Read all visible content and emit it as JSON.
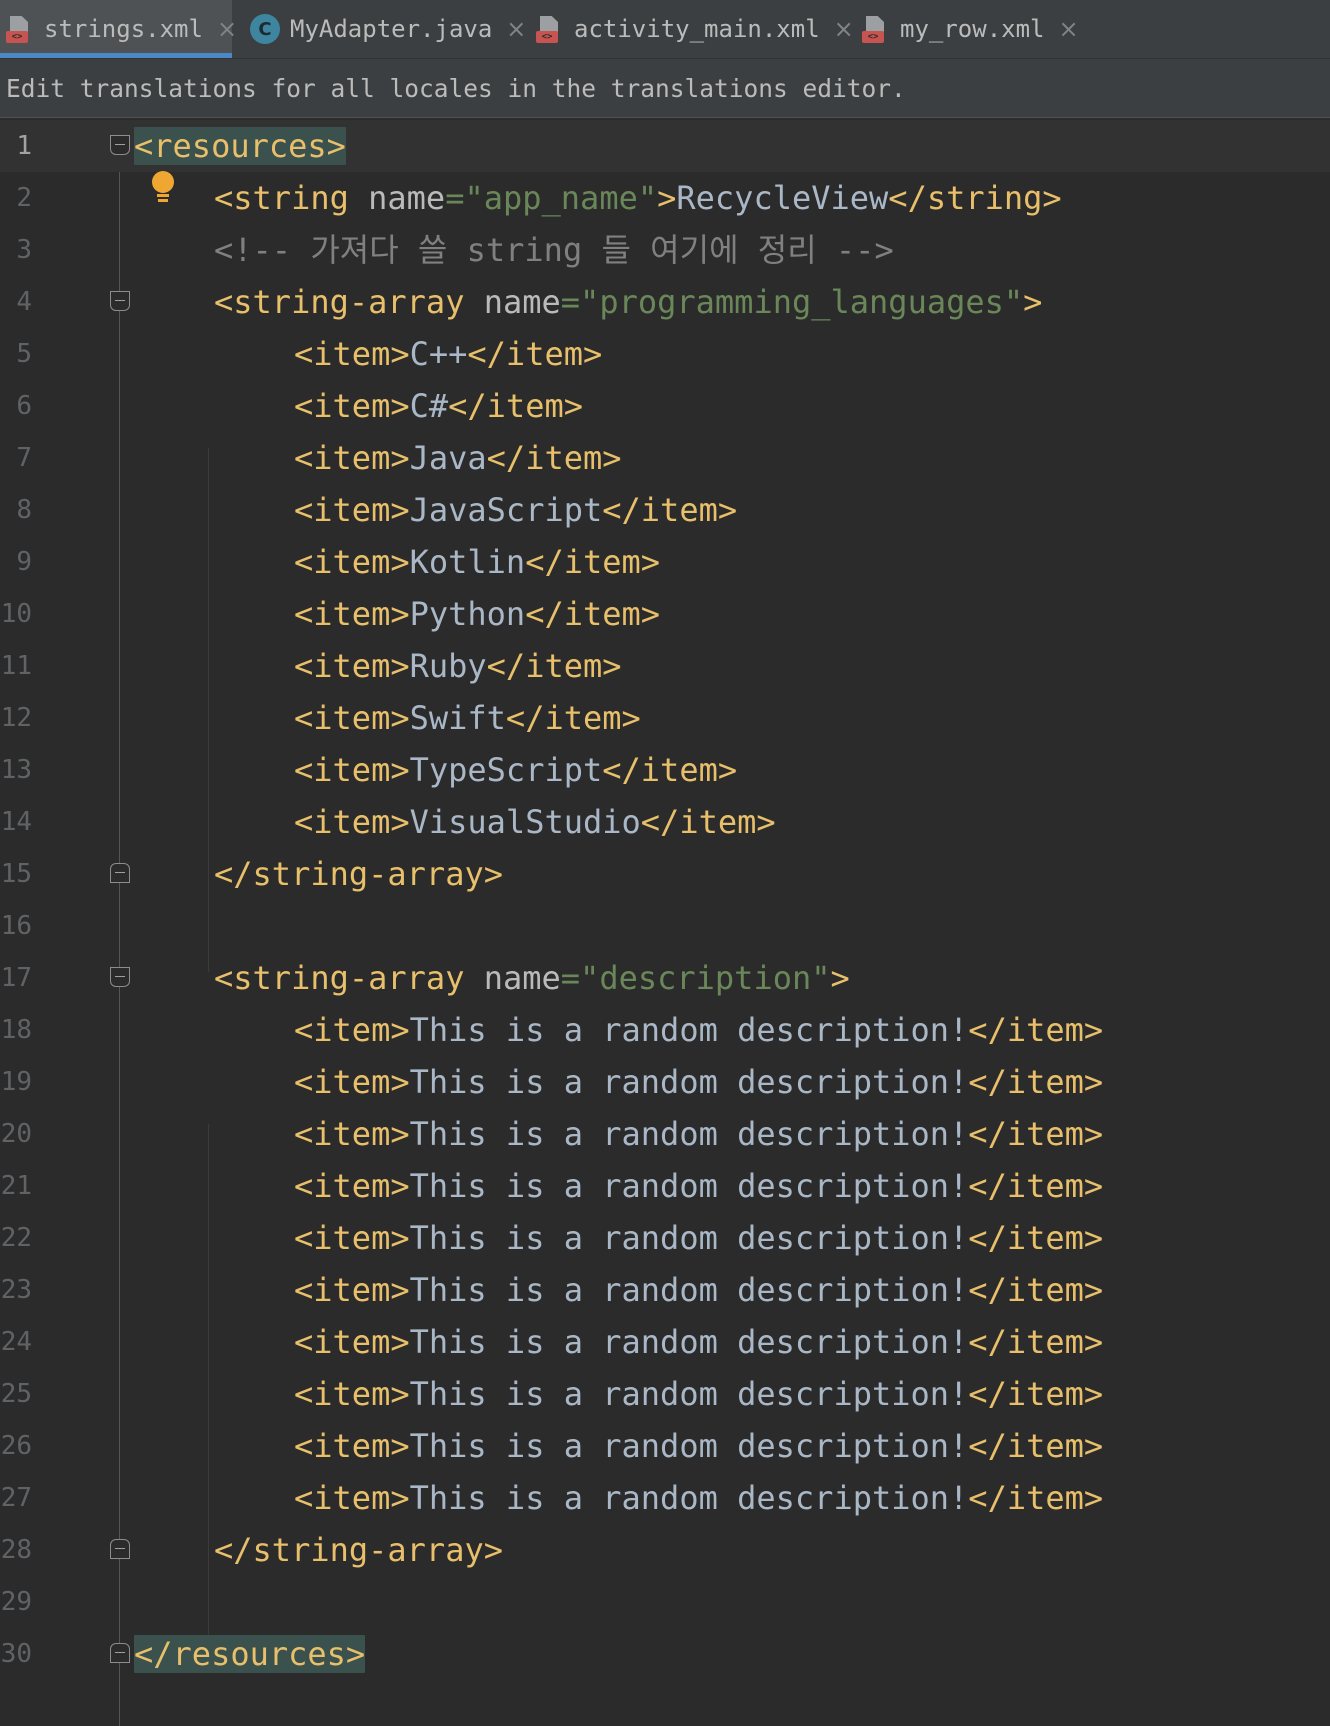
{
  "tabs": [
    {
      "label": "strings.xml",
      "icon": "xml-file-icon",
      "active": true
    },
    {
      "label": "MyAdapter.java",
      "icon": "java-class-icon",
      "active": false
    },
    {
      "label": "activity_main.xml",
      "icon": "xml-file-icon",
      "active": false
    },
    {
      "label": "my_row.xml",
      "icon": "xml-file-icon",
      "active": false
    }
  ],
  "banner": {
    "text": "Edit translations for all locales in the translations editor."
  },
  "editor": {
    "line_numbers": [
      "1",
      "2",
      "3",
      "4",
      "5",
      "6",
      "7",
      "8",
      "9",
      "10",
      "11",
      "12",
      "13",
      "14",
      "15",
      "16",
      "17",
      "18",
      "19",
      "20",
      "21",
      "22",
      "23",
      "24",
      "25",
      "26",
      "27",
      "28",
      "29",
      "30"
    ],
    "code": {
      "resources_open": "<resources>",
      "resources_close": "</resources>",
      "string_open": "<string",
      "attr_name": "name",
      "eq": "=",
      "app_name_value": "\"app_name\"",
      "gt": ">",
      "app_name_text": "RecycleView",
      "string_close": "</string>",
      "comment": "<!-- 가져다 쓸 string 들 여기에 정리 -->",
      "array_open": "<string-array",
      "array_name_1": "\"programming_languages\"",
      "array_name_2": "\"description\"",
      "array_close": "</string-array>",
      "item_open": "<item>",
      "item_close": "</item>",
      "languages": [
        "C++",
        "C#",
        "Java",
        "JavaScript",
        "Kotlin",
        "Python",
        "Ruby",
        "Swift",
        "TypeScript",
        "VisualStudio"
      ],
      "description_item": "This is a random description!"
    }
  },
  "colors": {
    "background": "#2b2b2b",
    "tag": "#e8bf6a",
    "attribute": "#bababa",
    "value": "#6a8759",
    "text": "#a9b7c6",
    "comment": "#808080",
    "tab_accent": "#4a88c7",
    "bulb": "#f0a732"
  }
}
